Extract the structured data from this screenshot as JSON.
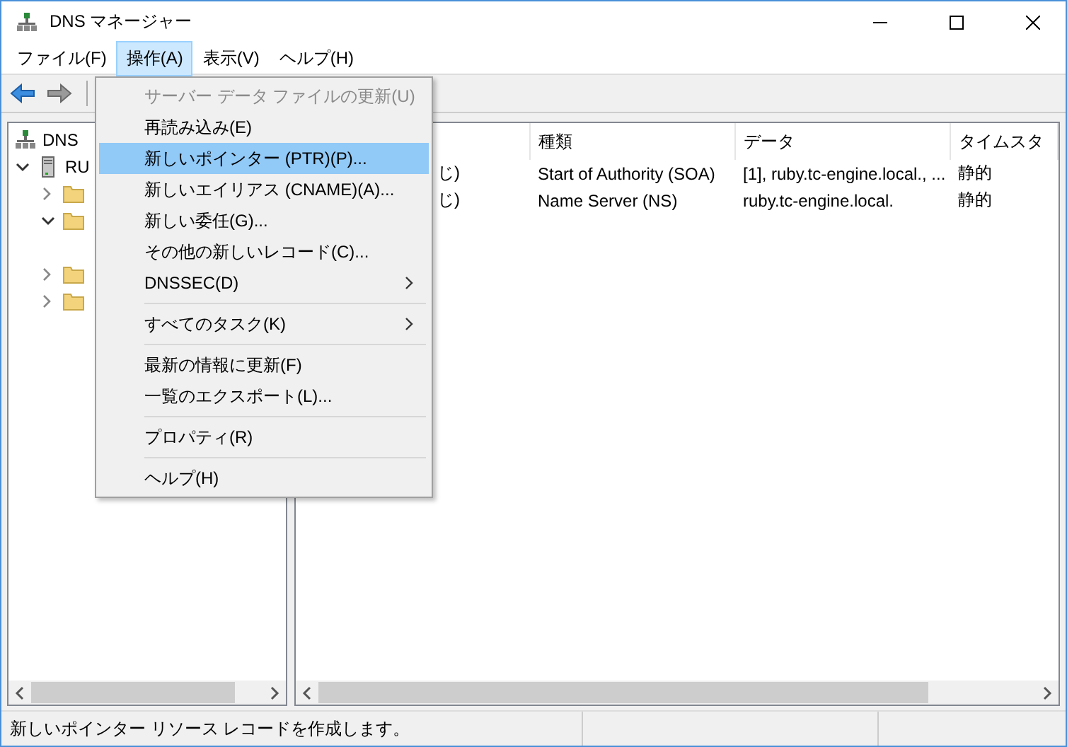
{
  "window": {
    "title": "DNS マネージャー"
  },
  "menubar": [
    {
      "label": "ファイル(F)",
      "selected": false
    },
    {
      "label": "操作(A)",
      "selected": true
    },
    {
      "label": "表示(V)",
      "selected": false
    },
    {
      "label": "ヘルプ(H)",
      "selected": false
    }
  ],
  "tree": [
    {
      "label": "DNS",
      "kind": "dns",
      "children": [
        {
          "label": "RU",
          "kind": "server",
          "expanded": true,
          "children": [
            {
              "kind": "folder",
              "expanded": false
            },
            {
              "kind": "folder",
              "expanded": true
            },
            {
              "kind": "folder",
              "expanded": false
            },
            {
              "kind": "folder",
              "expanded": false
            }
          ]
        }
      ]
    }
  ],
  "table": {
    "columns": [
      "",
      "種類",
      "データ",
      "タイムスタ"
    ],
    "rows": [
      [
        "じ)",
        "Start of Authority (SOA)",
        "[1], ruby.tc-engine.local., ...",
        "静的"
      ],
      [
        "じ)",
        "Name Server (NS)",
        "ruby.tc-engine.local.",
        "静的"
      ]
    ]
  },
  "menu": [
    {
      "label": "サーバー データ ファイルの更新(U)",
      "disabled": true,
      "selected": false
    },
    {
      "label": "再読み込み(E)",
      "disabled": false,
      "selected": false
    },
    {
      "label": "新しいポインター (PTR)(P)...",
      "disabled": false,
      "selected": true
    },
    {
      "label": "新しいエイリアス (CNAME)(A)...",
      "disabled": false,
      "selected": false
    },
    {
      "label": "新しい委任(G)...",
      "disabled": false,
      "selected": false
    },
    {
      "label": "その他の新しいレコード(C)...",
      "disabled": false,
      "selected": false
    },
    {
      "label": "DNSSEC(D)",
      "disabled": false,
      "selected": false,
      "kind": "submenu"
    },
    {
      "kind": "separator"
    },
    {
      "label": "すべてのタスク(K)",
      "disabled": false,
      "selected": false,
      "kind": "submenu"
    },
    {
      "kind": "separator"
    },
    {
      "label": "最新の情報に更新(F)",
      "disabled": false,
      "selected": false
    },
    {
      "label": "一覧のエクスポート(L)...",
      "disabled": false,
      "selected": false
    },
    {
      "kind": "separator"
    },
    {
      "label": "プロパティ(R)",
      "disabled": false,
      "selected": false
    },
    {
      "kind": "separator"
    },
    {
      "label": "ヘルプ(H)",
      "disabled": false,
      "selected": false
    }
  ],
  "status_bar": "新しいポインター リソース レコードを作成します。"
}
